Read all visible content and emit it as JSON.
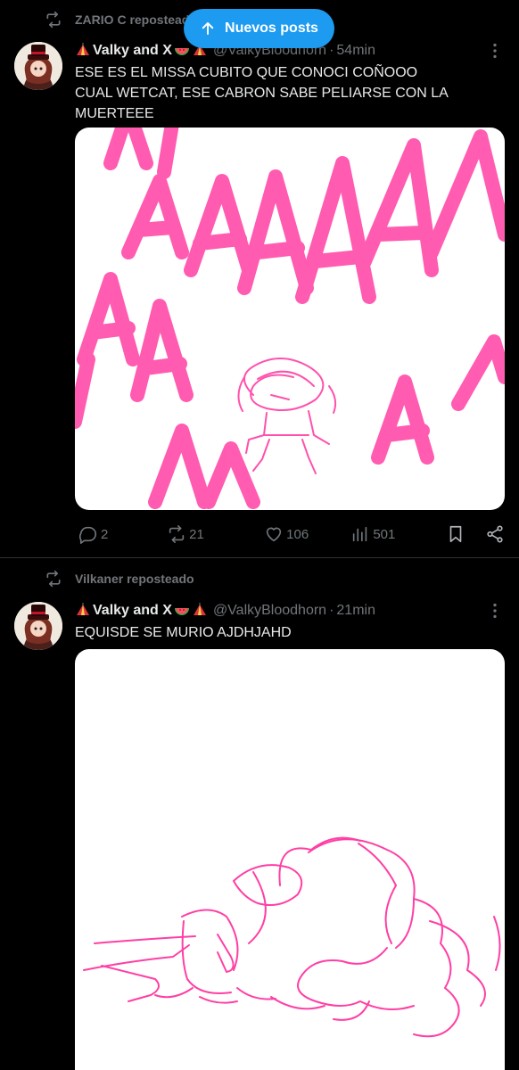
{
  "new_posts_pill": {
    "label": "Nuevos posts",
    "icon": "arrow-up-icon",
    "color": "#1d9bf0"
  },
  "posts": [
    {
      "reposted_by": "ZARIO C reposteado",
      "author_name": "Valky and X",
      "handle": "@ValkyBloodhorn",
      "separator": "·",
      "time": "54min",
      "text": "ESE ES EL MISSA CUBITO QUE CONOCI COÑOOO\nCUAL WETCAT, ESE CABRON SABE PELIARSE CON  LA\nMUERTEEE",
      "stats": {
        "replies": "2",
        "reposts": "21",
        "likes": "106",
        "views": "501"
      }
    },
    {
      "reposted_by": "Vilkaner reposteado",
      "author_name": "Valky and X",
      "handle": "@ValkyBloodhorn",
      "separator": "·",
      "time": "21min",
      "text": "EQUISDE SE MURIO AJDHJAHD"
    }
  ],
  "colors": {
    "background": "#000000",
    "text": "#e7e9ea",
    "muted": "#71767b",
    "accent": "#1d9bf0",
    "drawing_pink": "#ff3fa4"
  }
}
